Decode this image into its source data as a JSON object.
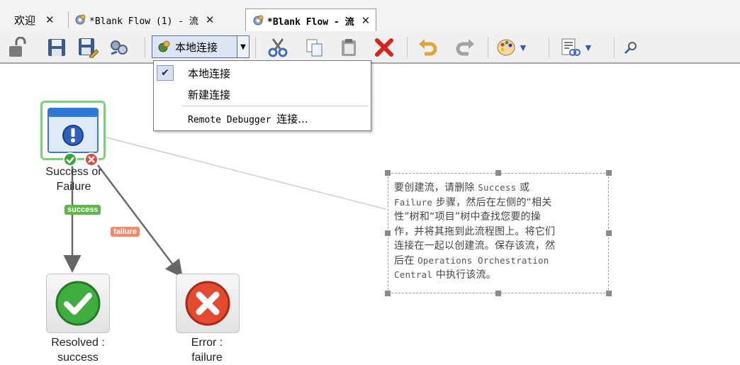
{
  "tabs": [
    {
      "label": "欢迎",
      "close": "✕",
      "active": false
    },
    {
      "label": "*Blank Flow (1) - 流",
      "close": "✕",
      "active": false
    },
    {
      "label": "*Blank Flow - 流",
      "close": "✕",
      "active": true
    }
  ],
  "toolbar": {
    "connection_label": "本地连接",
    "icons": [
      "unlock-icon",
      "save-icon",
      "save-as-icon",
      "properties-icon",
      "cut-icon",
      "copy-icon",
      "paste-icon",
      "delete-icon",
      "undo-icon",
      "redo-icon",
      "palette-icon",
      "view-options-icon",
      "zoom-icon"
    ]
  },
  "connection_menu": {
    "items": [
      {
        "label": "本地连接",
        "checked": true
      },
      {
        "label": "新建连接",
        "checked": false
      },
      {
        "label_prefix": "Remote Debugger ",
        "label_suffix": "连接...",
        "checked": false
      }
    ]
  },
  "flow": {
    "start_step": {
      "label_line1": "Success or",
      "label_line2": "Failure"
    },
    "success_badge": "success",
    "failure_badge": "failure",
    "resolved_step": {
      "label_line1": "Resolved :",
      "label_line2": "success"
    },
    "error_step": {
      "label_line1": "Error :",
      "label_line2": "failure"
    },
    "note": {
      "line1_a": "要创建流，请删除 ",
      "line1_b": "Success",
      "line1_c": " 或",
      "line2_a": "Failure",
      "line2_b": " 步骤，然后在左侧的“相关",
      "line3": "性”树和“项目”树中查找您要的操",
      "line4": "作，并将其拖到此流程图上。将它们",
      "line5": "连接在一起以创建流。保存该流，然",
      "line6_a": "后在 ",
      "line6_b": "Operations Orchestration",
      "line7_a": "Central",
      "line7_b": " 中执行该流。"
    }
  },
  "colors": {
    "success_badge": "#5db84a",
    "failure_badge": "#ef8a6a",
    "selection_border": "#7cd07a",
    "connection_select_bg": "#dde5f4"
  }
}
